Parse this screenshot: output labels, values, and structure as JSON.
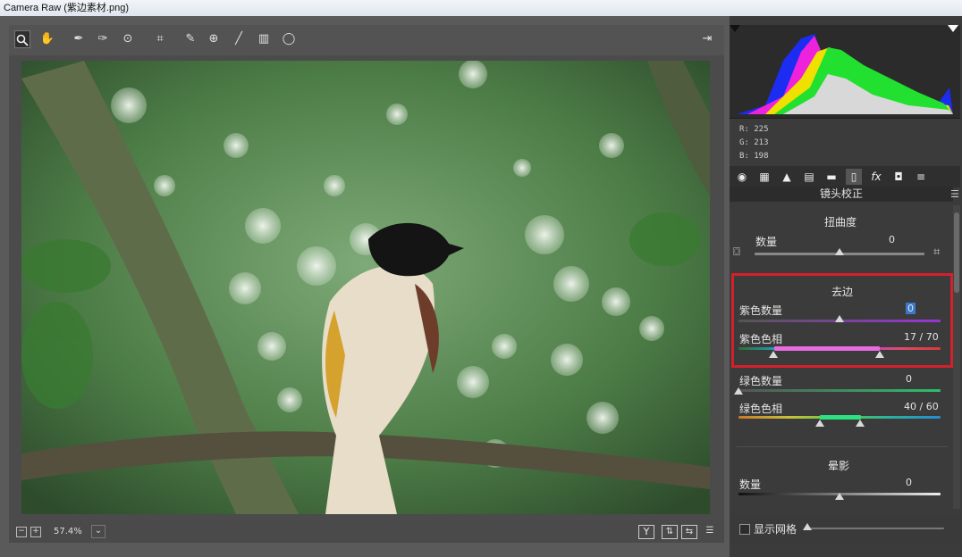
{
  "window": {
    "title": "Camera Raw (紫边素材.png)"
  },
  "toolbar": {
    "tools": [
      "zoom-tool",
      "hand-tool",
      "white-balance-tool",
      "color-sampler-tool",
      "targeted-adjustment-tool",
      "crop-tool",
      "spot-removal-tool",
      "red-eye-tool",
      "adjustment-brush-tool",
      "graduated-filter-tool",
      "radial-filter-tool"
    ],
    "active_tool": "zoom-tool",
    "right_icon": "open-preferences-icon"
  },
  "status": {
    "zoom": "57.4%",
    "view_buttons": [
      "Y",
      "before-after-icon",
      "swap-icon",
      "settings-icon"
    ]
  },
  "histogram": {
    "r_label": "R:",
    "r_value": "225",
    "g_label": "G:",
    "g_value": "213",
    "b_label": "B:",
    "b_value": "198"
  },
  "panel": {
    "tabs": [
      "basic-icon",
      "tone-curve-icon",
      "detail-icon",
      "hsl-icon",
      "split-toning-icon",
      "lens-corrections-icon",
      "fx-icon",
      "camera-calibration-icon",
      "presets-icon"
    ],
    "title": "镜头校正",
    "distortion": {
      "heading": "扭曲度",
      "amount_label": "数量",
      "amount_value": "0",
      "amount_fraction": 0.5
    },
    "defringe": {
      "heading": "去边",
      "purple_amount_label": "紫色数量",
      "purple_amount_value": "0",
      "purple_amount_fraction": 0.5,
      "purple_hue_label": "紫色色相",
      "purple_hue_value": "17 / 70",
      "purple_hue_range": [
        17,
        70
      ],
      "green_amount_label": "绿色数量",
      "green_amount_value": "0",
      "green_amount_fraction": 0.0,
      "green_hue_label": "绿色色相",
      "green_hue_value": "40 / 60",
      "green_hue_range": [
        40,
        60
      ]
    },
    "vignette": {
      "heading": "晕影",
      "amount_label": "数量",
      "amount_value": "0",
      "amount_fraction": 0.5
    },
    "grid": {
      "label": "显示网格",
      "checked": false
    }
  },
  "colors": {
    "highlight": "#d3202a",
    "purple": "#8a2bd0",
    "green": "#2cc06a"
  }
}
